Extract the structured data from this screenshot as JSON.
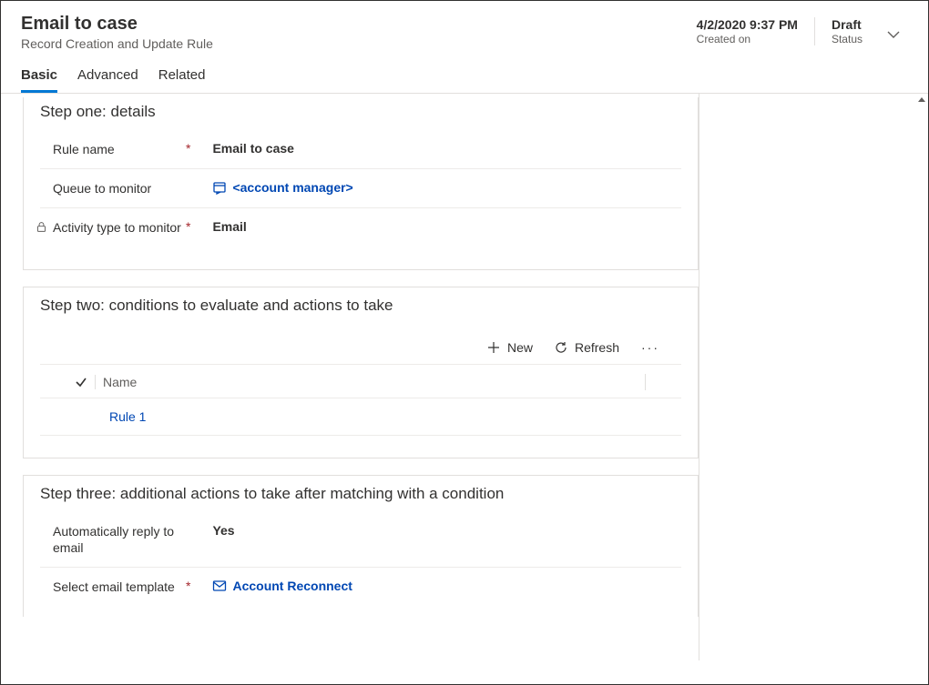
{
  "header": {
    "title": "Email to case",
    "subtitle": "Record Creation and Update Rule",
    "created_on_value": "4/2/2020 9:37 PM",
    "created_on_label": "Created on",
    "status_value": "Draft",
    "status_label": "Status"
  },
  "tabs": {
    "basic": "Basic",
    "advanced": "Advanced",
    "related": "Related"
  },
  "step_one": {
    "title": "Step one: details",
    "rule_name_label": "Rule name",
    "rule_name_value": "Email to case",
    "queue_label": "Queue to monitor",
    "queue_value": "<account manager>",
    "activity_type_label": "Activity type to monitor",
    "activity_type_value": "Email"
  },
  "step_two": {
    "title": "Step two: conditions to evaluate and actions to take",
    "new_label": "New",
    "refresh_label": "Refresh",
    "column_name": "Name",
    "rows": [
      {
        "name": "Rule 1"
      }
    ]
  },
  "step_three": {
    "title": "Step three: additional actions to take after matching with a condition",
    "auto_reply_label": "Automatically reply to email",
    "auto_reply_value": "Yes",
    "template_label": "Select email template",
    "template_value": "Account Reconnect"
  }
}
